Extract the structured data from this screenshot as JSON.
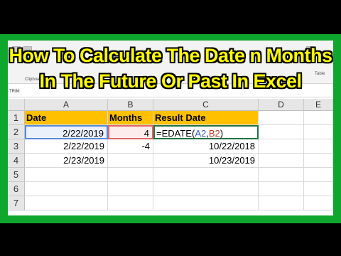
{
  "title": {
    "line1": "How To Calculate The Date n Months",
    "line2": "In The Future Or Past In Excel"
  },
  "ribbon": {
    "clipboard_label": "Clipboard",
    "table_label": "Table",
    "name_box": "TRIM"
  },
  "columns": [
    "A",
    "B",
    "C",
    "D",
    "E"
  ],
  "rows": [
    "1",
    "2",
    "3",
    "4",
    "5",
    "6",
    "7"
  ],
  "cells": {
    "A1": "Date",
    "B1": "Months",
    "C1": "Result Date",
    "A2": "2/22/2019",
    "B2": "4",
    "C2_prefix": "=EDATE(",
    "C2_ref_a": "A2",
    "C2_comma": ",",
    "C2_ref_b": "B2",
    "C2_suffix": ")",
    "A3": "2/22/2019",
    "B3": "-4",
    "C3": "10/22/2018",
    "A4": "2/23/2019",
    "C4": "10/23/2019"
  },
  "colors": {
    "header_fill": "#ffc000",
    "frame_green": "#0fa62d",
    "title_yellow": "#ffff00"
  }
}
